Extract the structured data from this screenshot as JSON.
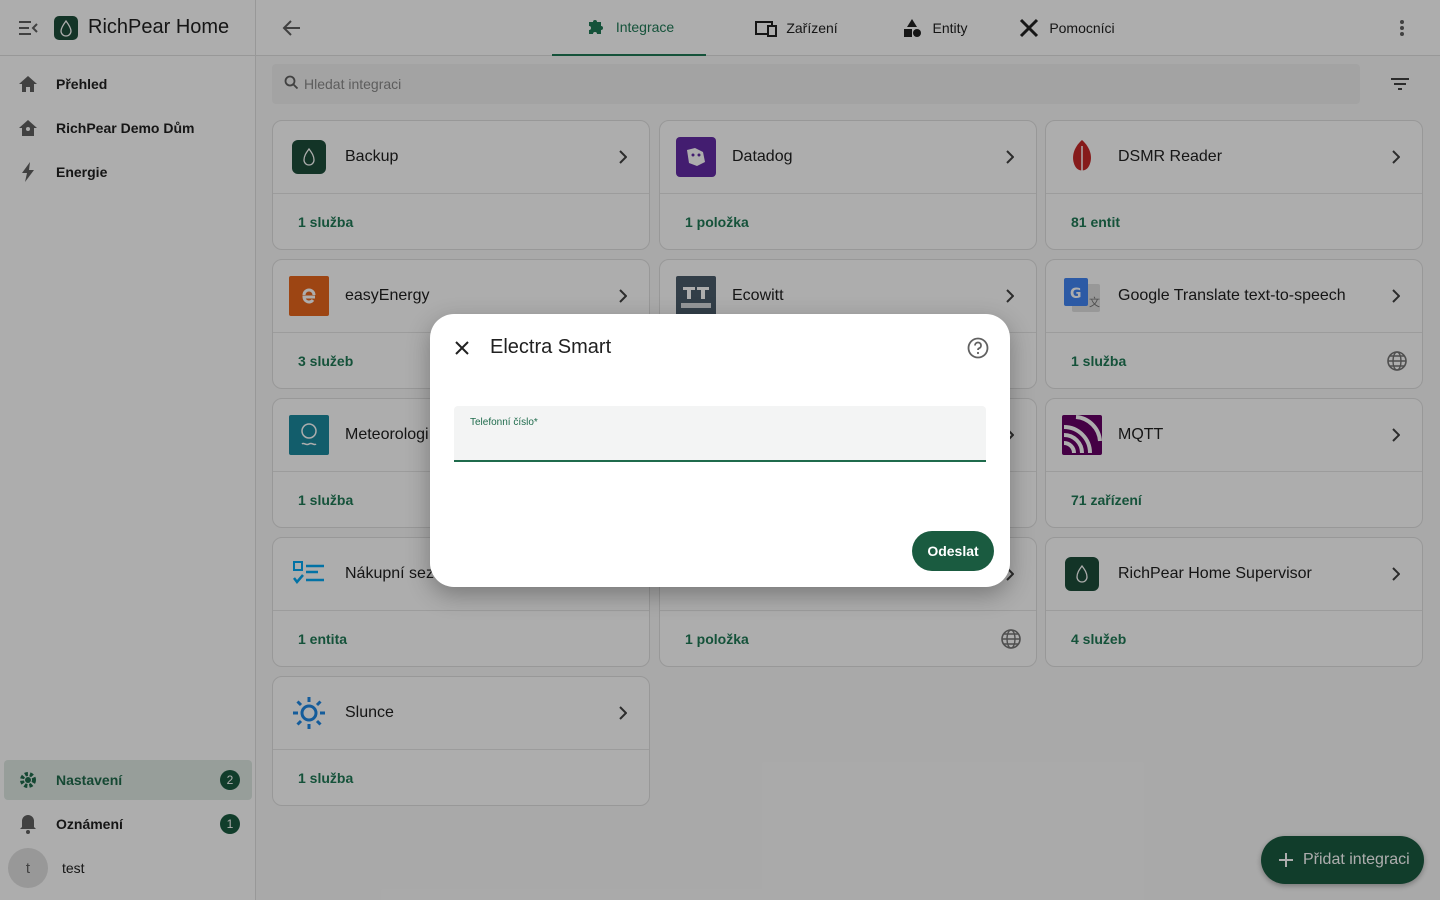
{
  "app": {
    "title": "RichPear Home"
  },
  "sidebar": {
    "items": [
      {
        "label": "Přehled",
        "icon": "home-icon"
      },
      {
        "label": "RichPear Demo Dům",
        "icon": "home-account-icon"
      },
      {
        "label": "Energie",
        "icon": "lightning-icon"
      }
    ],
    "bottom": {
      "settings": {
        "label": "Nastavení",
        "badge": "2"
      },
      "notifications": {
        "label": "Oznámení",
        "badge": "1"
      },
      "user": {
        "initial": "t",
        "name": "test"
      }
    }
  },
  "tabs": [
    {
      "label": "Integrace",
      "icon": "puzzle-icon",
      "active": true
    },
    {
      "label": "Zařízení",
      "icon": "devices-icon",
      "active": false
    },
    {
      "label": "Entity",
      "icon": "shapes-icon",
      "active": false
    },
    {
      "label": "Pomocníci",
      "icon": "tools-icon",
      "active": false
    }
  ],
  "search": {
    "placeholder": "Hledat integraci",
    "value": ""
  },
  "cards": [
    {
      "name": "Backup",
      "link": "1 služba",
      "logo": "backup-logo",
      "cloud": false
    },
    {
      "name": "Datadog",
      "link": "1 položka",
      "logo": "datadog-logo",
      "cloud": false
    },
    {
      "name": "DSMR Reader",
      "link": "81 entit",
      "logo": "dsmr-logo",
      "cloud": false
    },
    {
      "name": "easyEnergy",
      "link": "3 služeb",
      "logo": "easyenergy-logo",
      "cloud": false
    },
    {
      "name": "Ecowitt",
      "link": "",
      "logo": "ecowitt-logo",
      "cloud": false
    },
    {
      "name": "Google Translate text-to-speech",
      "link": "1 služba",
      "logo": "google-translate-logo",
      "cloud": true
    },
    {
      "name": "Meteorologi",
      "link": "1 služba",
      "logo": "met-logo",
      "cloud": false
    },
    {
      "name": "",
      "link": "",
      "logo": "",
      "cloud": false
    },
    {
      "name": "MQTT",
      "link": "71 zařízení",
      "logo": "mqtt-logo",
      "cloud": false
    },
    {
      "name": "Nákupní sez",
      "link": "1 entita",
      "logo": "shopping-list-logo",
      "cloud": false
    },
    {
      "name": "",
      "link": "1 položka",
      "logo": "",
      "cloud": true
    },
    {
      "name": "RichPear Home Supervisor",
      "link": "4 služeb",
      "logo": "supervisor-logo",
      "cloud": false
    },
    {
      "name": "Slunce",
      "link": "1 služba",
      "logo": "sun-logo",
      "cloud": false
    }
  ],
  "fab": {
    "label": "Přidat integraci"
  },
  "dialog": {
    "title": "Electra Smart",
    "field_label": "Telefonní číslo*",
    "field_value": "",
    "submit_label": "Odeslat"
  }
}
